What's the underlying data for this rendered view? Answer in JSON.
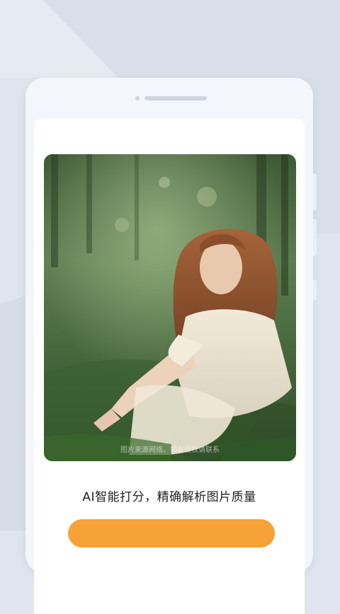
{
  "screen": {
    "faint_header": "",
    "photo": {
      "description_icon": "portrait-photo",
      "watermark": "图片来源网络，如有侵权请联系"
    },
    "tagline": "AI智能打分，精确解析图片质量",
    "cta_label": ""
  },
  "colors": {
    "background": "#dfe4ee",
    "phone_frame": "#f3f6fc",
    "cta": "#f7a237"
  }
}
